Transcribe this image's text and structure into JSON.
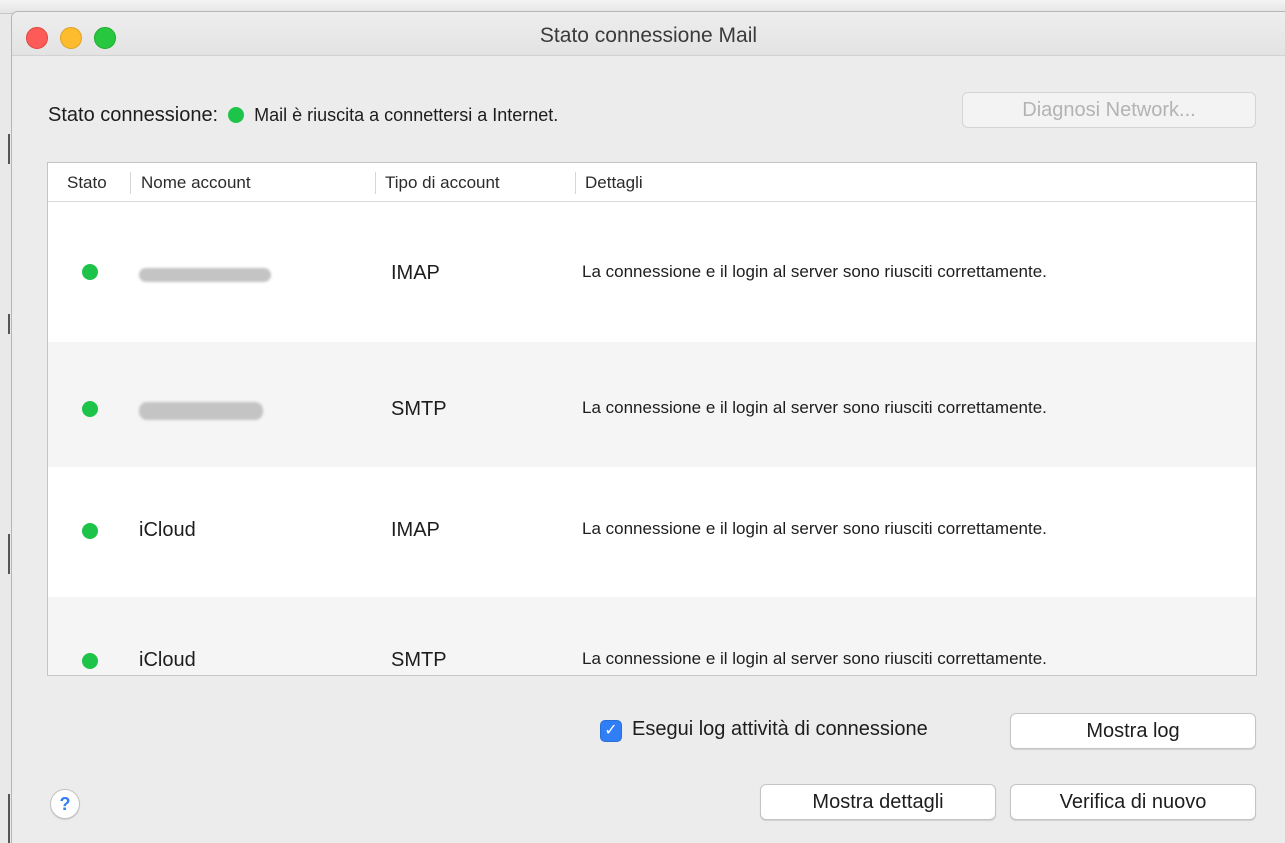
{
  "window": {
    "title": "Stato connessione Mail"
  },
  "status": {
    "label": "Stato connessione:",
    "message": "Mail è riuscita a connettersi a Internet.",
    "color": "#1ec44a"
  },
  "buttons": {
    "network_diagnosis": "Diagnosi Network...",
    "show_log": "Mostra log",
    "show_details": "Mostra dettagli",
    "check_again": "Verifica di nuovo"
  },
  "table": {
    "columns": [
      "Stato",
      "Nome account",
      "Tipo di account",
      "Dettagli"
    ],
    "rows": [
      {
        "name": "",
        "type": "IMAP",
        "details": "La connessione e il login al server sono riusciti correttamente."
      },
      {
        "name": "",
        "type": "SMTP",
        "details": "La connessione e il login al server sono riusciti correttamente."
      },
      {
        "name": "iCloud",
        "type": "IMAP",
        "details": "La connessione e il login al server sono riusciti correttamente."
      },
      {
        "name": "iCloud",
        "type": "SMTP",
        "details": "La connessione e il login al server sono riusciti correttamente."
      }
    ]
  },
  "log": {
    "label": "Esegui log attività di connessione",
    "checked": true
  },
  "icons": {
    "help": "help-icon",
    "status": "green-status-dot-icon",
    "checkbox": "checkmark-icon"
  },
  "help": {
    "glyph": "?"
  }
}
